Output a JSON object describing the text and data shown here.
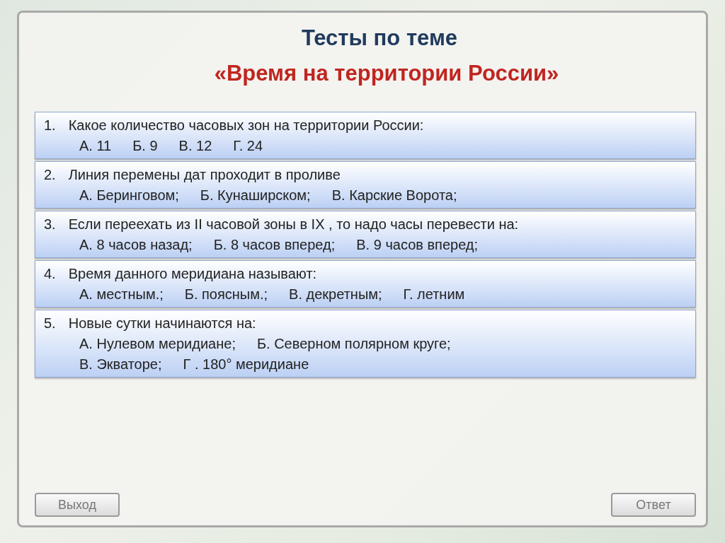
{
  "title": "Тесты по теме",
  "subtitle": "«Время на территории России»",
  "questions": [
    {
      "number": "1.",
      "text": "Какое количество часовых зон на территории России:",
      "answer_lines": [
        [
          "А.  11",
          "Б.  9",
          "В.  12",
          "Г.  24"
        ]
      ]
    },
    {
      "number": "2.",
      "text": "Линия перемены дат проходит в проливе",
      "answer_lines": [
        [
          "А.  Беринговом;",
          "Б.  Кунаширском;",
          "В.  Карские Ворота;"
        ]
      ]
    },
    {
      "number": "3.",
      "text": "Если переехать из II часовой зоны в IX , то надо часы перевести на:",
      "answer_lines": [
        [
          "А.  8 часов назад;",
          "Б.  8 часов вперед;",
          "В.  9 часов вперед;"
        ]
      ]
    },
    {
      "number": "4.",
      "text": "Время данного меридиана называют:",
      "answer_lines": [
        [
          "А.  местным.;",
          "Б. поясным.;",
          "В. декретным;",
          "Г. летним"
        ]
      ]
    },
    {
      "number": "5.",
      "text": "Новые сутки начинаются на:",
      "answer_lines": [
        [
          "А.  Нулевом меридиане;",
          "Б.  Северном полярном круге;"
        ],
        [
          "В. Экваторе;",
          "Г . 180° меридиане"
        ]
      ]
    }
  ],
  "buttons": {
    "exit": "Выход",
    "answer": "Ответ"
  }
}
